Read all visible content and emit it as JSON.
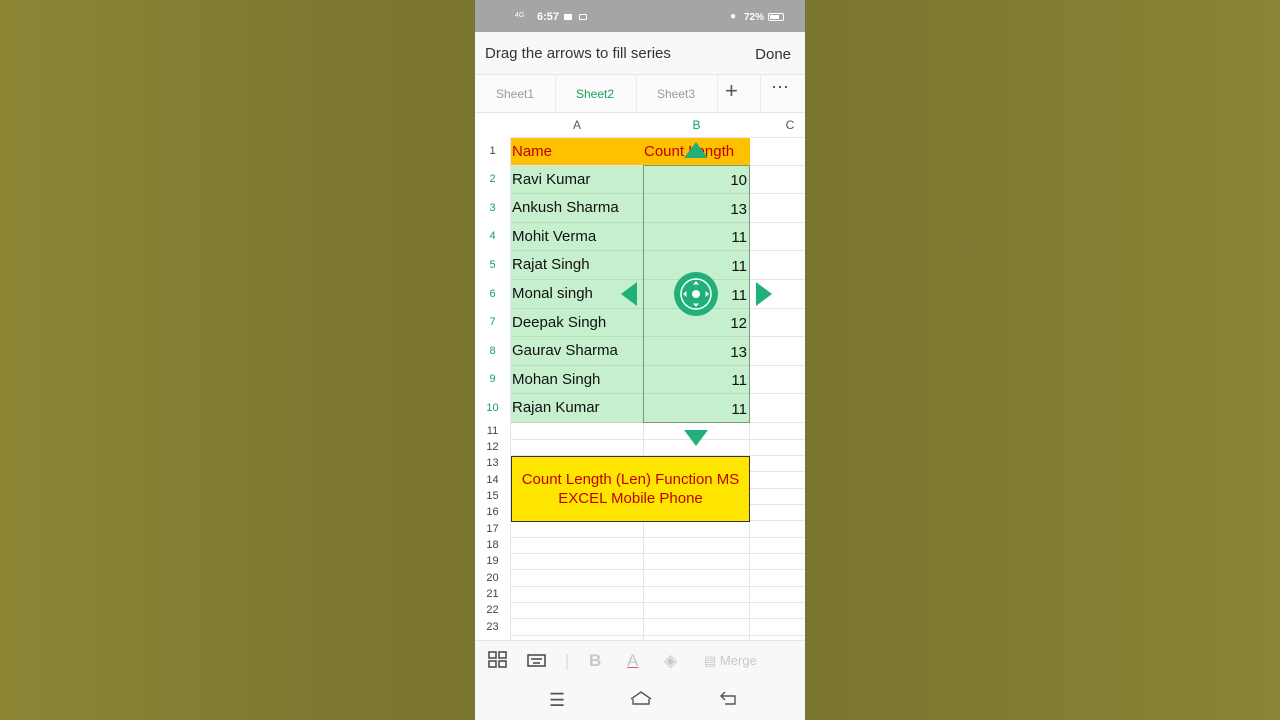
{
  "status_bar": {
    "signal": "4G",
    "time": "6:57",
    "battery": "72%"
  },
  "fill_bar": {
    "message": "Drag the arrows to fill series",
    "done_label": "Done"
  },
  "sheet_tabs": [
    {
      "label": "Sheet1",
      "active": false
    },
    {
      "label": "Sheet2",
      "active": true
    },
    {
      "label": "Sheet3",
      "active": false
    }
  ],
  "tab_actions": {
    "add_icon": "plus-icon",
    "more_icon": "more-icon"
  },
  "columns": [
    "A",
    "B",
    "C"
  ],
  "selected_column": "B",
  "row_numbers": [
    "1",
    "2",
    "3",
    "4",
    "5",
    "6",
    "7",
    "8",
    "9",
    "10",
    "11",
    "12",
    "13",
    "14",
    "15",
    "16",
    "17",
    "18",
    "19",
    "20",
    "21",
    "22",
    "23"
  ],
  "table": {
    "headers": [
      "Name",
      "Count Length"
    ],
    "rows": [
      {
        "name": "Ravi Kumar",
        "count": "10"
      },
      {
        "name": "Ankush Sharma",
        "count": "13"
      },
      {
        "name": "Mohit Verma",
        "count": "11"
      },
      {
        "name": "Rajat Singh",
        "count": "11"
      },
      {
        "name": "Monal singh",
        "count": "11"
      },
      {
        "name": "Deepak Singh",
        "count": "12"
      },
      {
        "name": "Gaurav Sharma",
        "count": "13"
      },
      {
        "name": "Mohan Singh",
        "count": "11"
      },
      {
        "name": "Rajan Kumar",
        "count": "11"
      }
    ]
  },
  "note_box": {
    "line1": "Count Length (Len) Function MS",
    "line2": "EXCEL Mobile Phone"
  },
  "toolbar": {
    "merge_label": "Merge"
  },
  "colors": {
    "accent": "#21b07a",
    "header_fill": "#ffc000",
    "header_text": "#c00000",
    "cell_fill": "#c6efce",
    "note_fill": "#ffe600"
  }
}
